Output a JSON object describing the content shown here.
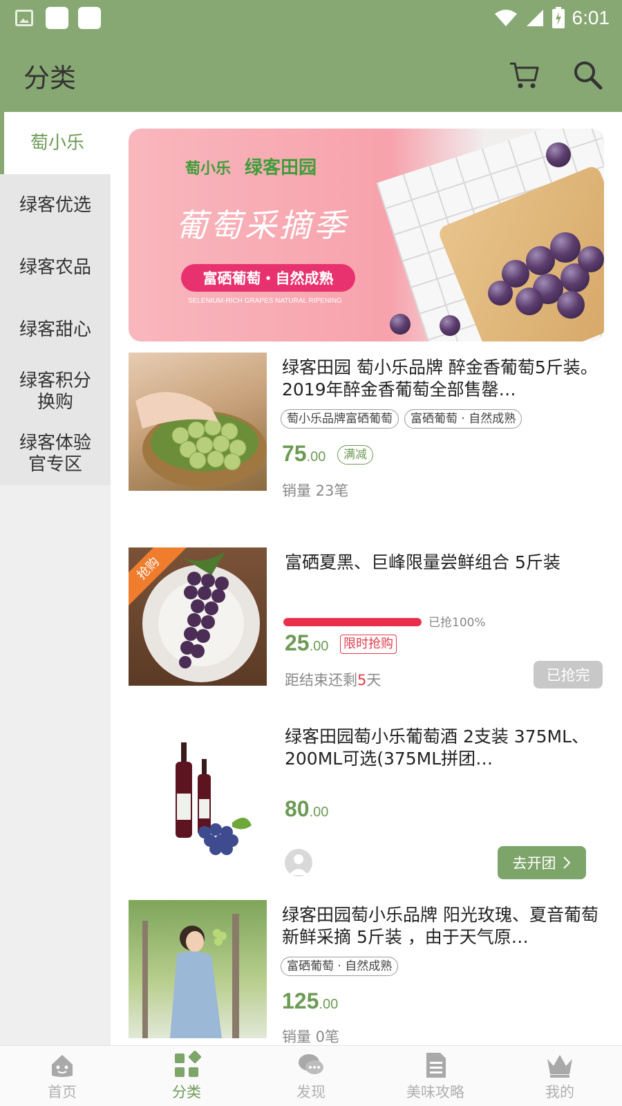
{
  "status_bar": {
    "time": "6:01"
  },
  "app_bar": {
    "title": "分类",
    "cart_icon": "cart-icon",
    "search_icon": "search-icon"
  },
  "colors": {
    "brand_green": "#87a873",
    "price_green": "#6d9a55",
    "alert_red": "#e03a4a"
  },
  "sidebar": {
    "items": [
      {
        "line1": "萄小乐",
        "line2": "",
        "active": true
      },
      {
        "line1": "绿客优选",
        "line2": ""
      },
      {
        "line1": "绿客农品",
        "line2": ""
      },
      {
        "line1": "绿客甜心",
        "line2": ""
      },
      {
        "line1": "绿客积分",
        "line2": "换购"
      },
      {
        "line1": "绿客体验",
        "line2": "官专区"
      }
    ]
  },
  "banner": {
    "logo_left": "萄小乐",
    "logo_right": "绿客田园",
    "headline": "葡萄采摘季",
    "pill": "富硒葡萄・自然成熟",
    "subtitle": "SELENIUM-RICH GRAPES NATURAL RIPENING"
  },
  "products": [
    {
      "title": "绿客田园 萄小乐品牌 醉金香葡萄5斤装。2019年醉金香葡萄全部售罄…",
      "tags": [
        "萄小乐品牌富硒葡萄",
        "富硒葡萄 · 自然成熟"
      ],
      "price_int": "75",
      "price_dec": ".00",
      "badge": "满减",
      "sales": "销量 23笔"
    },
    {
      "title": "富硒夏黑、巨峰限量尝鲜组合 5斤装",
      "ribbon": "抢购",
      "progress_fraction": 1.0,
      "progress_text": "已抢100%",
      "price_int": "25",
      "price_dec": ".00",
      "badge": "限时抢购",
      "countdown_prefix": "距结束还剩",
      "countdown_value": "5",
      "countdown_suffix": "天",
      "button": "已抢完"
    },
    {
      "title": "绿客田园萄小乐葡萄酒 2支装 375ML、200ML可选(375ML拼团…",
      "price_int": "80",
      "price_dec": ".00",
      "button": "去开团"
    },
    {
      "title": "绿客田园萄小乐品牌 阳光玫瑰、夏音葡萄 新鲜采摘 5斤装 ，由于天气原…",
      "tags": [
        "富硒葡萄 · 自然成熟"
      ],
      "price_int": "125",
      "price_dec": ".00",
      "sales": "销量 0笔"
    }
  ],
  "bottom_nav": [
    {
      "label": "首页",
      "icon": "home-icon"
    },
    {
      "label": "分类",
      "icon": "category-icon",
      "active": true
    },
    {
      "label": "发现",
      "icon": "discover-icon"
    },
    {
      "label": "美味攻略",
      "icon": "guide-icon"
    },
    {
      "label": "我的",
      "icon": "crown-icon"
    }
  ]
}
